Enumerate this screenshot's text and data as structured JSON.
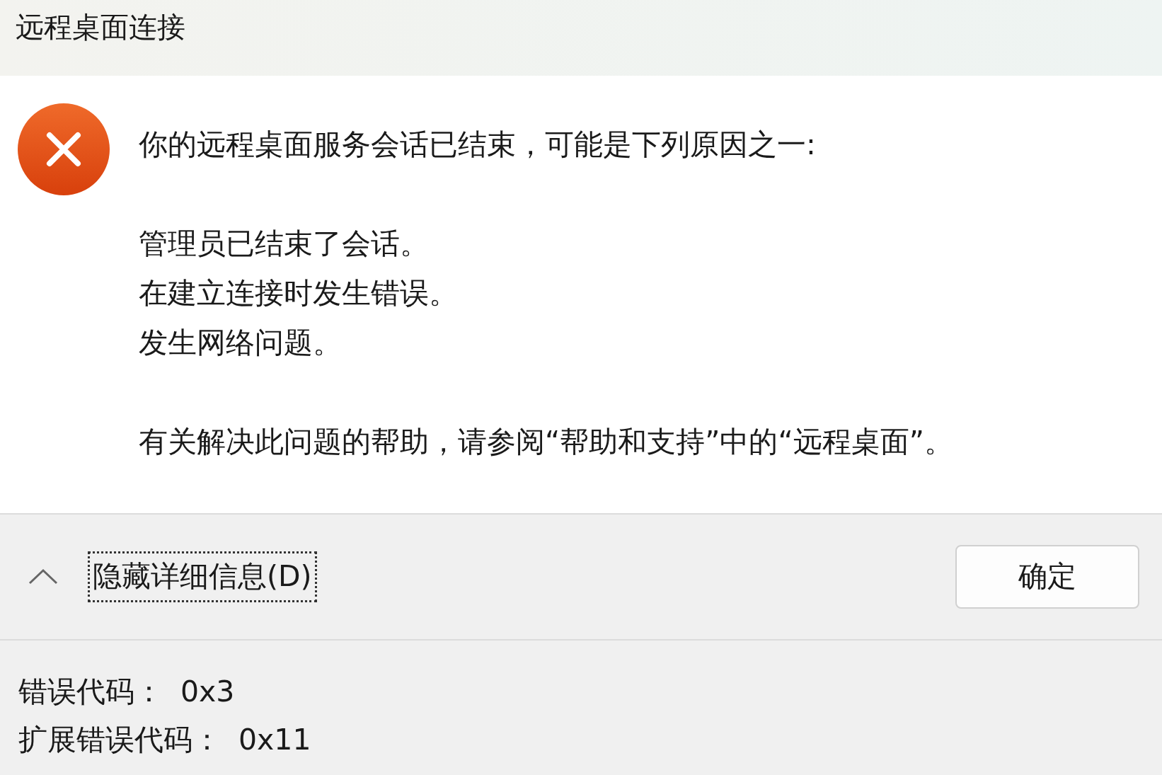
{
  "window": {
    "title": "远程桌面连接"
  },
  "message": {
    "intro": "你的远程桌面服务会话已结束，可能是下列原因之一:",
    "reasons": [
      "管理员已结束了会话。",
      "在建立连接时发生错误。",
      "发生网络问题。"
    ],
    "help": "有关解决此问题的帮助，请参阅“帮助和支持”中的“远程桌面”。"
  },
  "details_toggle": {
    "label": "隐藏详细信息(D)",
    "expanded": true
  },
  "buttons": [
    {
      "label": "确定"
    }
  ],
  "details": [
    {
      "label": "错误代码：",
      "value": "0x3"
    },
    {
      "label": "扩展错误代码：",
      "value": "0x11"
    }
  ]
}
